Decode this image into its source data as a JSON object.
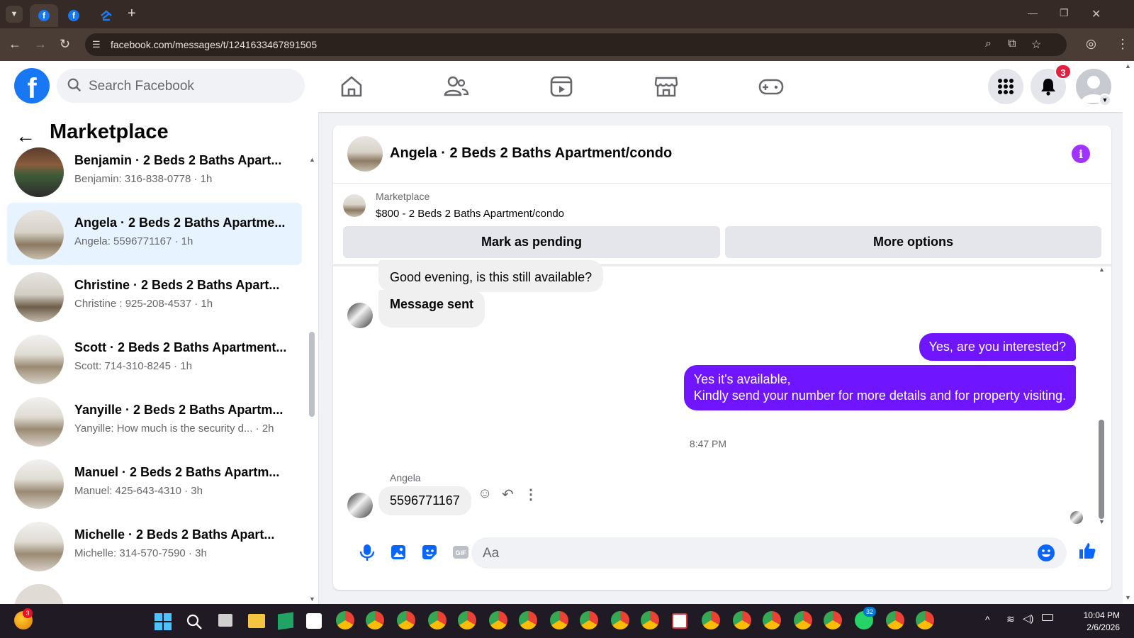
{
  "browser": {
    "url": "facebook.com/messages/t/1241633467891505",
    "tab_icon_fb": "f"
  },
  "header": {
    "search_placeholder": "Search Facebook",
    "notifications_count": "3"
  },
  "sidebar": {
    "title": "Marketplace",
    "conversations": [
      {
        "title": "Benjamin · 2 Beds 2 Baths Apart...",
        "subtitle": "Benjamin: 316-838-0778 · 1h"
      },
      {
        "title": "Angela · 2 Beds 2 Baths Apartme...",
        "subtitle": "Angela: 5596771167 · 1h"
      },
      {
        "title": "Christine · 2 Beds 2 Baths Apart...",
        "subtitle": "Christine : 925-208-4537 · 1h"
      },
      {
        "title": "Scott · 2 Beds 2 Baths Apartment...",
        "subtitle": "Scott: 714-310-8245 · 1h"
      },
      {
        "title": "Yanyille · 2 Beds 2 Baths Apartm...",
        "subtitle": "Yanyille: How much is the security d... · 2h"
      },
      {
        "title": "Manuel · 2 Beds 2 Baths Apartm...",
        "subtitle": "Manuel: 425-643-4310 · 3h"
      },
      {
        "title": "Michelle · 2 Beds 2 Baths Apart...",
        "subtitle": "Michelle: 314-570-7590 · 3h"
      }
    ]
  },
  "chat": {
    "title": "Angela · 2 Beds 2 Baths Apartment/condo",
    "marketplace_label": "Marketplace",
    "listing": "$800 - 2 Beds 2 Baths Apartment/condo",
    "mark_pending": "Mark as pending",
    "more_options": "More options",
    "messages": {
      "in_1": "Good evening, is this still available?",
      "in_2": "Message sent",
      "out_1": "Yes, are you interested?",
      "out_2_line1": "Yes it's available,",
      "out_2_line2": "Kindly send your number for more details and for property visiting.",
      "timestamp": "8:47 PM",
      "sender": "Angela",
      "in_3": "5596771167"
    },
    "composer_placeholder": "Aa"
  },
  "taskbar": {
    "time": "10:04 PM",
    "date": "2/6/2026",
    "weather_badge": "3",
    "whatsapp_badge": "32"
  },
  "colors": {
    "fb_blue": "#1877f2",
    "outgoing_bubble": "#7015ff",
    "notification_red": "#e41e3f",
    "selected_row": "#e7f3ff"
  }
}
